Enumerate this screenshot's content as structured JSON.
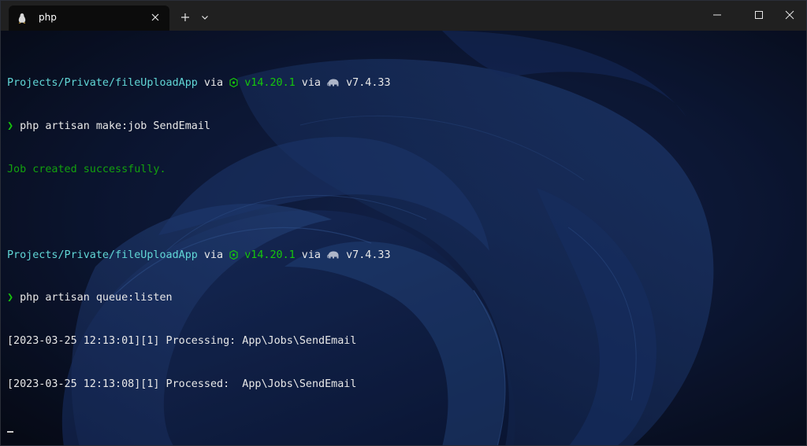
{
  "tab": {
    "title": "php",
    "icon": "linux-tux-icon",
    "close_label": "✕"
  },
  "toolbar": {
    "new_tab_label": "+",
    "dropdown_label": "⌄"
  },
  "window_controls": {
    "minimize": "—",
    "maximize": "☐",
    "close": "✕"
  },
  "terminal": {
    "block1": {
      "path": "Projects/Private/fileUploadApp",
      "via1": " via ",
      "node_version": "v14.20.1",
      "via2": " via ",
      "php_version": "v7.4.33",
      "prompt": "❯",
      "command": "php artisan make:job SendEmail",
      "output": "Job created successfully."
    },
    "block2": {
      "path": "Projects/Private/fileUploadApp",
      "via1": " via ",
      "node_version": "v14.20.1",
      "via2": " via ",
      "php_version": "v7.4.33",
      "prompt": "❯",
      "command": "php artisan queue:listen",
      "log1": "[2023-03-25 12:13:01][1] Processing: App\\Jobs\\SendEmail",
      "log2": "[2023-03-25 12:13:08][1] Processed:  App\\Jobs\\SendEmail"
    }
  },
  "colors": {
    "path": "#61d6d6",
    "node": "#16c60c",
    "success": "#13a10e",
    "titlebar": "#202020",
    "tab_bg": "#0c0c0c"
  }
}
